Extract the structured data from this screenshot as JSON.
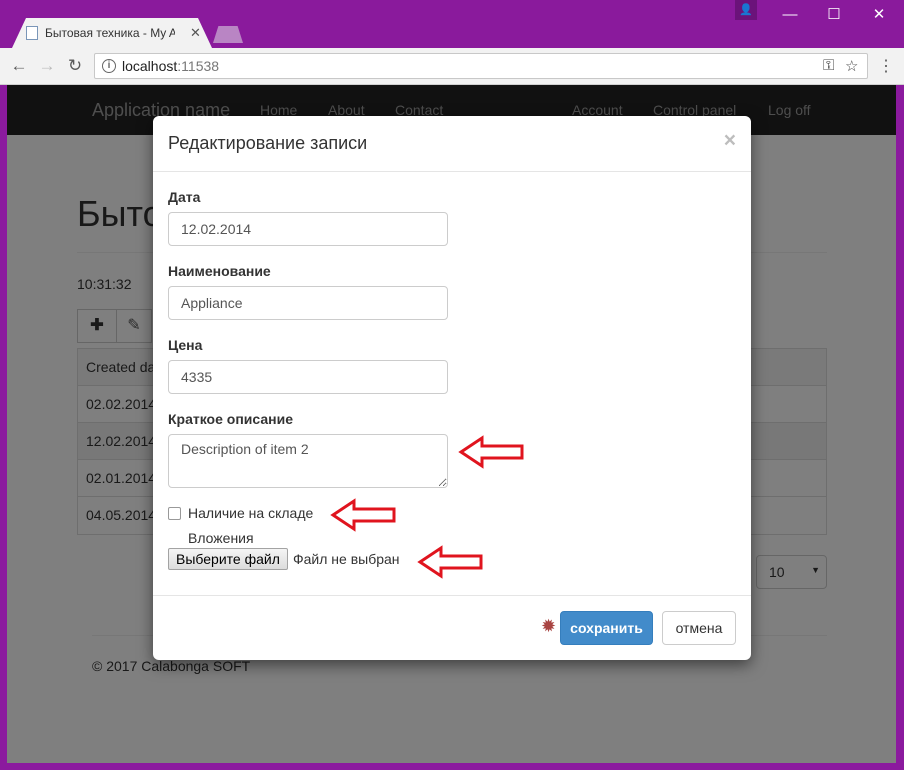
{
  "browser": {
    "tab_title": "Бытовая техника - My A",
    "url_host": "localhost",
    "url_port": ":11538",
    "colors": {
      "frame": "#8a1a9c",
      "toolbar": "#f2f2f2"
    }
  },
  "page": {
    "navbar": {
      "brand": "Application name",
      "links": [
        "Home",
        "About",
        "Contact"
      ],
      "right_links": [
        "Account",
        "Control panel",
        "Log off"
      ]
    },
    "heading": "Быто",
    "clock": "10:31:32",
    "toolbar_buttons": [
      "add-icon",
      "edit-icon"
    ],
    "grid": {
      "header": "Created da",
      "rows": [
        "02.02.2014",
        "12.02.2014",
        "02.01.2014",
        "04.05.2014"
      ]
    },
    "page_size": "10",
    "footer": "© 2017 Calabonga SOFT"
  },
  "modal": {
    "title": "Редактирование записи",
    "close_glyph": "×",
    "fields": {
      "date": {
        "label": "Дата",
        "value": "12.02.2014"
      },
      "name": {
        "label": "Наименование",
        "value": "Appliance"
      },
      "price": {
        "label": "Цена",
        "value": "4335"
      },
      "description": {
        "label": "Краткое описание",
        "value": "Description of item 2"
      }
    },
    "in_stock": {
      "label": "Наличие на складе",
      "checked": false
    },
    "attachments": {
      "label": "Вложения",
      "button": "Выберите файл",
      "status": "Файл не выбран"
    },
    "save_button": "сохранить",
    "cancel_button": "отмена",
    "colors": {
      "primary": "#428bca",
      "required_marker": "#a94442",
      "annotation_arrow": "#e0141e"
    }
  }
}
